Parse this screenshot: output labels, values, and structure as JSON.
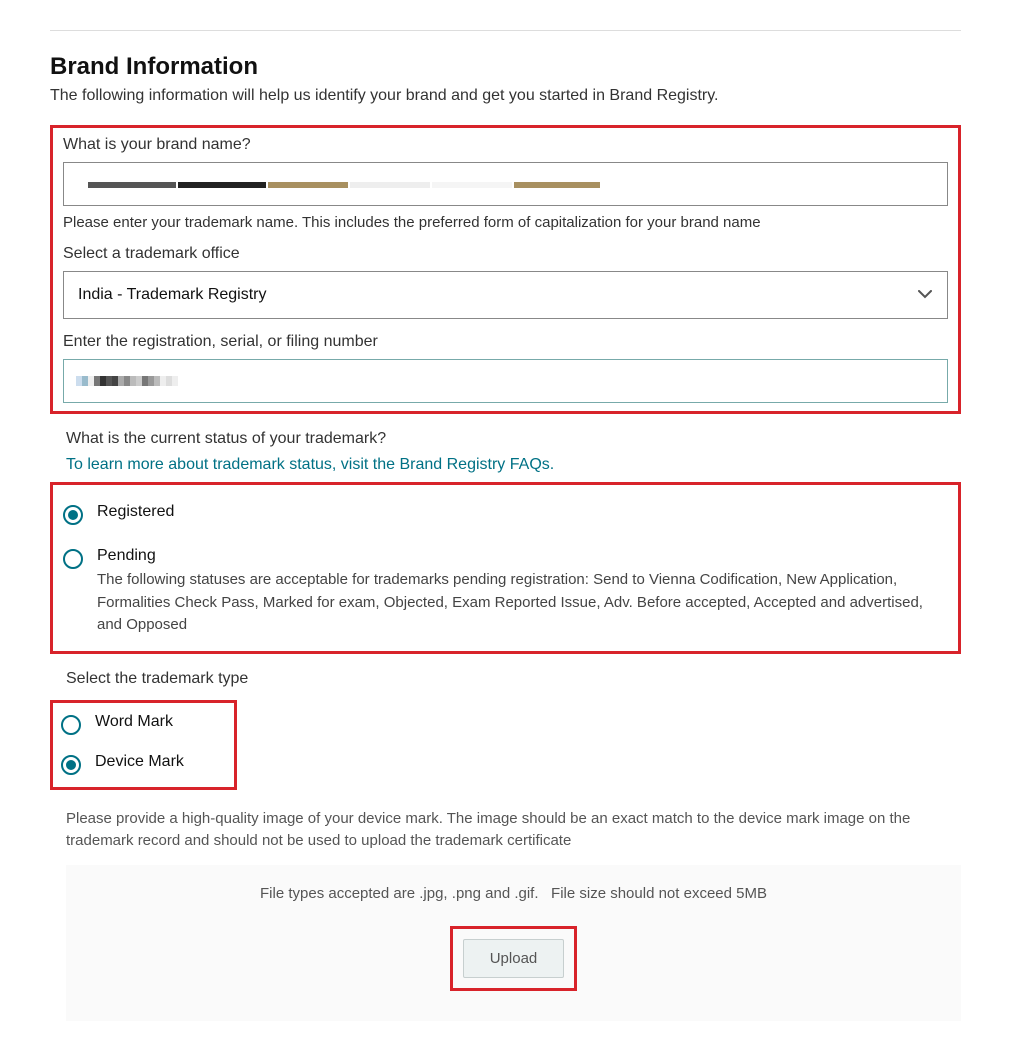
{
  "header": {
    "title": "Brand Information",
    "subtitle": "The following information will help us identify your brand and get you started in Brand Registry."
  },
  "brandName": {
    "label": "What is your brand name?",
    "helper": "Please enter your trademark name. This includes the preferred form of capitalization for your brand name"
  },
  "trademarkOffice": {
    "label": "Select a trademark office",
    "selected": "India - Trademark Registry"
  },
  "registration": {
    "label": "Enter the registration, serial, or filing number"
  },
  "status": {
    "label": "What is the current status of your trademark?",
    "link": "To learn more about trademark status, visit the Brand Registry FAQs.",
    "options": {
      "registered": "Registered",
      "pending": "Pending",
      "pendingDesc": "The following statuses are acceptable for trademarks pending registration: Send to Vienna Codification, New Application, Formalities Check Pass, Marked for exam, Objected, Exam Reported Issue, Adv. Before accepted, Accepted and advertised, and Opposed"
    }
  },
  "trademarkType": {
    "label": "Select the trademark type",
    "options": {
      "word": "Word Mark",
      "device": "Device Mark"
    }
  },
  "upload": {
    "note": "Please provide a high-quality image of your device mark. The image should be an exact match to the device mark image on the trademark record and should not be used to upload the trademark certificate",
    "info1": "File types accepted are .jpg, .png and .gif.",
    "info2": "File size should not exceed 5MB",
    "button": "Upload"
  }
}
